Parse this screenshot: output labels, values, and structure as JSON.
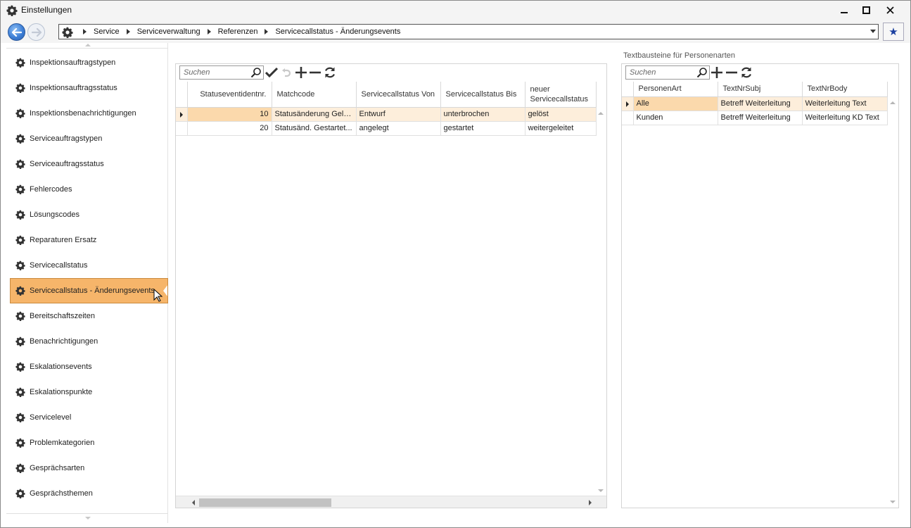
{
  "window": {
    "title": "Einstellungen",
    "app_icon": "gear-icon"
  },
  "nav": {
    "breadcrumbs": [
      "Service",
      "Serviceverwaltung",
      "Referenzen",
      "Servicecallstatus - Änderungsevents"
    ],
    "favorite_icon": "star-icon"
  },
  "sidebar": {
    "items": [
      {
        "label": "Inspektionsauftragstypen"
      },
      {
        "label": "Inspektionsauftragsstatus"
      },
      {
        "label": "Inspektionsbenachrichtigungen"
      },
      {
        "label": "Serviceauftragstypen"
      },
      {
        "label": "Serviceauftragsstatus"
      },
      {
        "label": "Fehlercodes"
      },
      {
        "label": "Lösungscodes"
      },
      {
        "label": "Reparaturen Ersatz"
      },
      {
        "label": "Servicecallstatus"
      },
      {
        "label": "Servicecallstatus - Änderungsevents"
      },
      {
        "label": "Bereitschaftszeiten"
      },
      {
        "label": "Benachrichtigungen"
      },
      {
        "label": "Eskalationsevents"
      },
      {
        "label": "Eskalationspunkte"
      },
      {
        "label": "Servicelevel"
      },
      {
        "label": "Problemkategorien"
      },
      {
        "label": "Gesprächsarten"
      },
      {
        "label": "Gesprächsthemen"
      }
    ],
    "active_index": 9
  },
  "main_grid": {
    "search_placeholder": "Suchen",
    "columns": [
      "Statuseventidentnr.",
      "Matchcode",
      "Servicecallstatus Von",
      "Servicecallstatus Bis",
      "neuer Servicecallstatus"
    ],
    "rows": [
      {
        "id": "10",
        "matchcode": "Statusänderung Gelöst",
        "von": "Entwurf",
        "bis": "unterbrochen",
        "neu": "gelöst"
      },
      {
        "id": "20",
        "matchcode": "Statusänd. Gestartet...",
        "von": "angelegt",
        "bis": "gestartet",
        "neu": "weitergeleitet"
      }
    ],
    "selected_row": 0
  },
  "right_grid": {
    "title": "Textbausteine für Personenarten",
    "search_placeholder": "Suchen",
    "columns": [
      "PersonenArt",
      "TextNrSubj",
      "TextNrBody"
    ],
    "rows": [
      {
        "art": "Alle",
        "subj": "Betreff Weiterleitung",
        "body": "Weiterleitung Text"
      },
      {
        "art": "Kunden",
        "subj": "Betreff Weiterleitung",
        "body": "Weiterleitung KD Text"
      }
    ],
    "selected_row": 0
  },
  "colors": {
    "active_item": "#f6b56a",
    "selected_row": "#fdeedb",
    "selected_cell": "#fbd9ac"
  }
}
